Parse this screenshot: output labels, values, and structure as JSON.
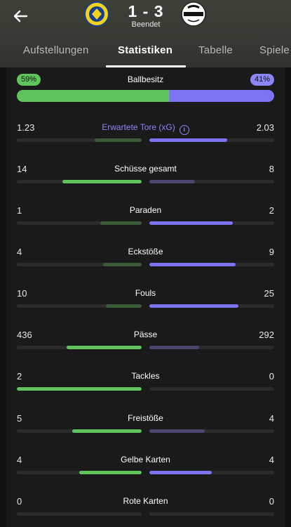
{
  "match": {
    "score": "1 - 3",
    "status": "Beendet",
    "home_crest": "home-team-crest-icon",
    "away_crest": "away-team-crest-icon"
  },
  "tabs": [
    {
      "label": "Aufstellungen",
      "active": false
    },
    {
      "label": "Statistiken",
      "active": true
    },
    {
      "label": "Tabelle",
      "active": false
    },
    {
      "label": "Spiele",
      "active": false
    }
  ],
  "possession": {
    "label": "Ballbesitz",
    "home": "59%",
    "away": "41%",
    "home_fraction": 0.59
  },
  "colors": {
    "home_strong": "#5fc45c",
    "home_weak": "#3b5a38",
    "away_strong": "#7c74f2",
    "away_weak": "#4a466e"
  },
  "stats": [
    {
      "label": "Erwartete Tore (xG)",
      "home": "1.23",
      "away": "2.03",
      "home_num": 1.23,
      "away_num": 2.03,
      "xg": true
    },
    {
      "label": "Schüsse gesamt",
      "home": "14",
      "away": "8",
      "home_num": 14,
      "away_num": 8
    },
    {
      "label": "Paraden",
      "home": "1",
      "away": "2",
      "home_num": 1,
      "away_num": 2
    },
    {
      "label": "Eckstöße",
      "home": "4",
      "away": "9",
      "home_num": 4,
      "away_num": 9
    },
    {
      "label": "Fouls",
      "home": "10",
      "away": "25",
      "home_num": 10,
      "away_num": 25
    },
    {
      "label": "Pässe",
      "home": "436",
      "away": "292",
      "home_num": 436,
      "away_num": 292
    },
    {
      "label": "Tackles",
      "home": "2",
      "away": "0",
      "home_num": 2,
      "away_num": 0
    },
    {
      "label": "Freistöße",
      "home": "5",
      "away": "4",
      "home_num": 5,
      "away_num": 4
    },
    {
      "label": "Gelbe Karten",
      "home": "4",
      "away": "4",
      "home_num": 4,
      "away_num": 4
    },
    {
      "label": "Rote Karten",
      "home": "0",
      "away": "0",
      "home_num": 0,
      "away_num": 0
    }
  ]
}
